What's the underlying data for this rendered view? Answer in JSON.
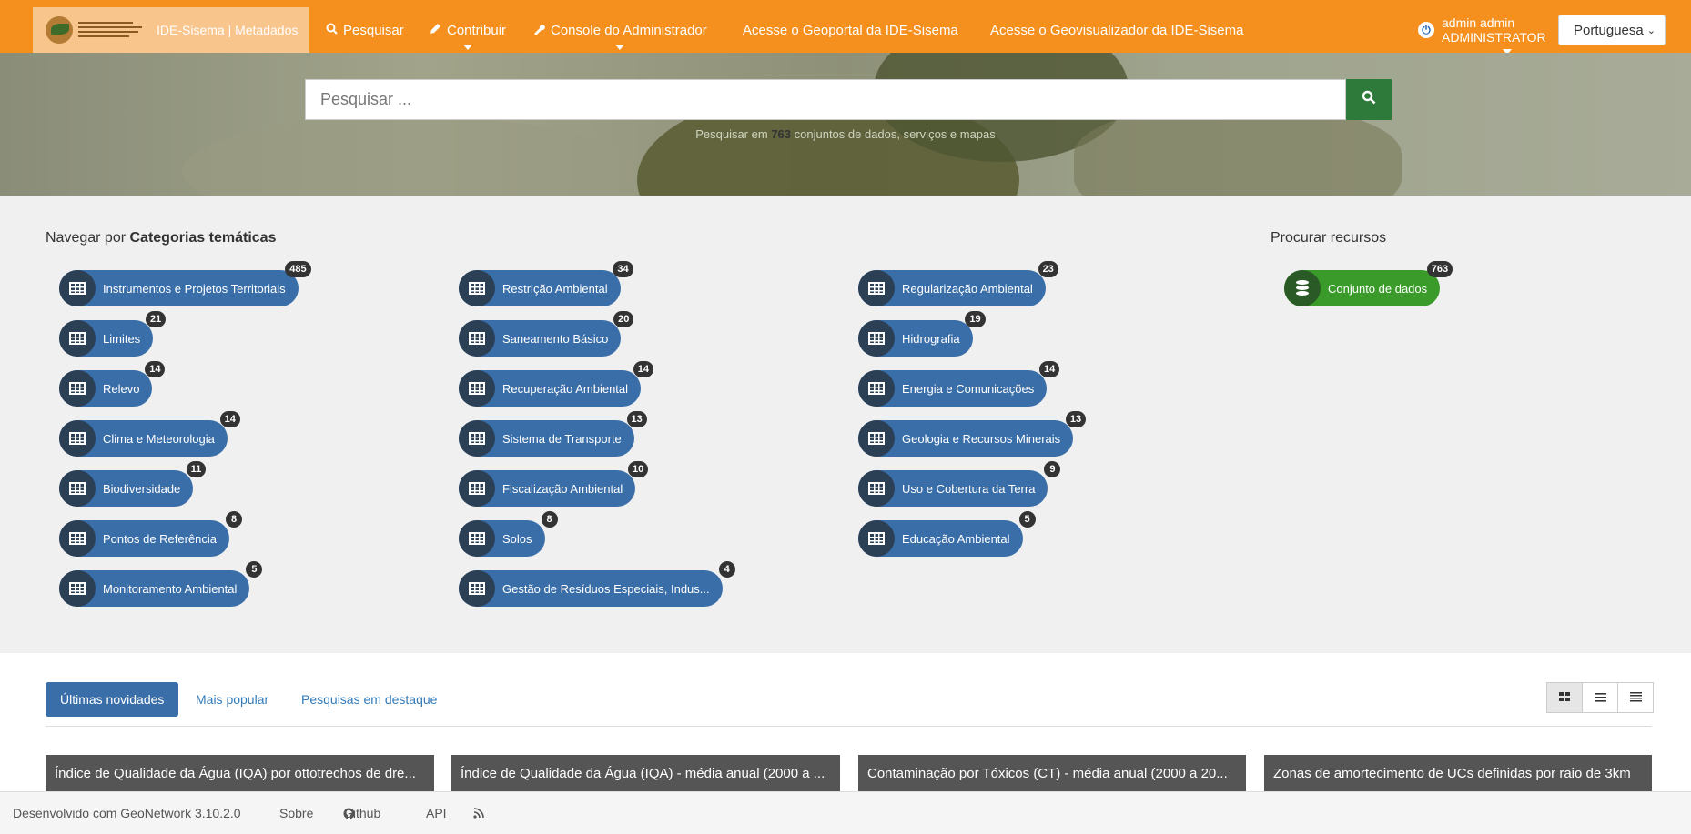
{
  "navbar": {
    "brand_text": "IDE-Sisema | Metadados",
    "logo_text": "Infraestrutura de Dados Espaciais do Sistema Estadual de Meio Ambiente e Recursos Hídricos",
    "items": [
      {
        "label": "Pesquisar",
        "icon": "search-icon"
      },
      {
        "label": "Contribuir",
        "icon": "pencil-icon"
      },
      {
        "label": "Console do Administrador",
        "icon": "wrench-icon"
      },
      {
        "label": "Acesse o Geoportal da IDE-Sisema"
      },
      {
        "label": "Acesse o Geovisualizador da IDE-Sisema"
      }
    ],
    "user_name": "admin admin",
    "user_role": "ADMINISTRATOR",
    "language": "Portuguesa"
  },
  "search": {
    "placeholder": "Pesquisar ...",
    "count_prefix": "Pesquisar em",
    "count": "763",
    "count_suffix": "conjuntos de dados, serviços e mapas"
  },
  "categories": {
    "title_prefix": "Navegar por",
    "title_bold": "Categorias temáticas",
    "items": [
      {
        "label": "Instrumentos e Projetos Territoriais",
        "count": "485"
      },
      {
        "label": "Limites",
        "count": "21"
      },
      {
        "label": "Relevo",
        "count": "14"
      },
      {
        "label": "Clima e Meteorologia",
        "count": "14"
      },
      {
        "label": "Biodiversidade",
        "count": "11"
      },
      {
        "label": "Pontos de Referência",
        "count": "8"
      },
      {
        "label": "Monitoramento Ambiental",
        "count": "5"
      },
      {
        "label": "Restrição Ambiental",
        "count": "34"
      },
      {
        "label": "Saneamento Básico",
        "count": "20"
      },
      {
        "label": "Recuperação Ambiental",
        "count": "14"
      },
      {
        "label": "Sistema de Transporte",
        "count": "13"
      },
      {
        "label": "Fiscalização Ambiental",
        "count": "10"
      },
      {
        "label": "Solos",
        "count": "8"
      },
      {
        "label": "Gestão de Resíduos Especiais, Indus...",
        "count": "4"
      },
      {
        "label": "Regularização Ambiental",
        "count": "23"
      },
      {
        "label": "Hidrografia",
        "count": "19"
      },
      {
        "label": "Energia e Comunicações",
        "count": "14"
      },
      {
        "label": "Geologia e Recursos Minerais",
        "count": "13"
      },
      {
        "label": "Uso e Cobertura da Terra",
        "count": "9"
      },
      {
        "label": "Educação Ambiental",
        "count": "5"
      }
    ]
  },
  "resources": {
    "title": "Procurar recursos",
    "item": {
      "label": "Conjunto de dados",
      "count": "763"
    }
  },
  "tabs": [
    {
      "label": "Últimas novidades",
      "active": true
    },
    {
      "label": "Mais popular"
    },
    {
      "label": "Pesquisas em destaque"
    }
  ],
  "cards": [
    "Índice de Qualidade da Água (IQA) por ottotrechos de dre...",
    "Índice de Qualidade da Água (IQA) - média anual (2000 a ...",
    "Contaminação por Tóxicos (CT) - média anual (2000 a 20...",
    "Zonas de amortecimento de UCs definidas por raio de 3km"
  ],
  "footer": {
    "developed": "Desenvolvido com GeoNetwork 3.10.2.0",
    "about": "Sobre",
    "github": "Github",
    "api": "API"
  },
  "colors": {
    "navbar": "#f5901e",
    "pill": "#3a6ea8",
    "pill_green": "#3a9a2a",
    "search_button": "#2e7a3a"
  }
}
